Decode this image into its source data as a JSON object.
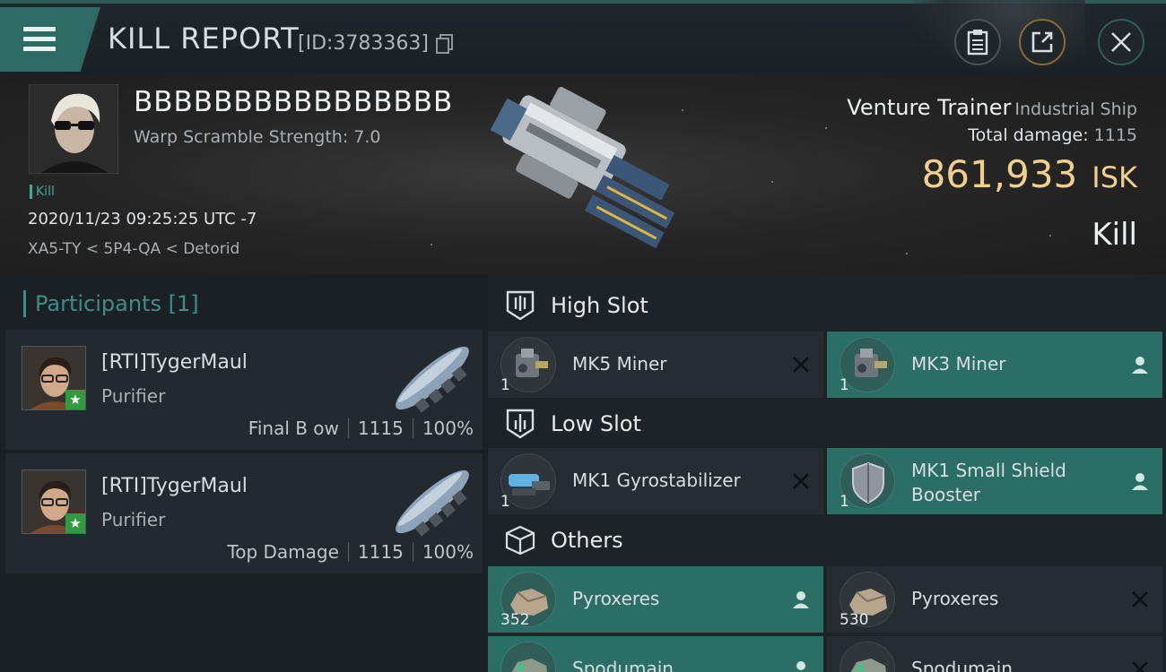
{
  "header": {
    "title": "KILL REPORT",
    "report_id": "[ID:3783363]"
  },
  "victim": {
    "name": "BBBBBBBBBBBBBBBB",
    "warp_scramble": "Warp Scramble Strength: 7.0",
    "tag": "Kill",
    "datetime": "2020/11/23 09:25:25 UTC -7",
    "location": "XA5-TY < 5P4-QA < Detorid"
  },
  "ship": {
    "name": "Venture Trainer",
    "class": "Industrial Ship",
    "total_damage_label": "Total damage:",
    "total_damage": "1115",
    "isk_value": "861,933",
    "isk_unit": "ISK",
    "result": "Kill"
  },
  "participants": {
    "title": "Participants",
    "count": "[1]",
    "rows": [
      {
        "pilot": "[RTI]TygerMaul",
        "ship": "Purifier",
        "role": "Final B ow",
        "damage": "1115",
        "percent": "100%"
      },
      {
        "pilot": "[RTI]TygerMaul",
        "ship": "Purifier",
        "role": "Top Damage",
        "damage": "1115",
        "percent": "100%"
      }
    ]
  },
  "slots": {
    "high": {
      "title": "High Slot",
      "items": [
        {
          "name": "MK5 Miner",
          "qty": "1",
          "status": "destroyed"
        },
        {
          "name": "MK3 Miner",
          "qty": "1",
          "status": "dropped"
        }
      ]
    },
    "low": {
      "title": "Low Slot",
      "items": [
        {
          "name": "MK1 Gyrostabilizer",
          "qty": "1",
          "status": "destroyed"
        },
        {
          "name": "MK1 Small Shield Booster",
          "qty": "1",
          "status": "dropped"
        }
      ]
    },
    "others": {
      "title": "Others",
      "items": [
        {
          "name": "Pyroxeres",
          "qty": "352",
          "status": "dropped"
        },
        {
          "name": "Pyroxeres",
          "qty": "530",
          "status": "destroyed"
        },
        {
          "name": "Spodumain",
          "qty": "",
          "status": "dropped"
        },
        {
          "name": "Spodumain",
          "qty": "",
          "status": "destroyed"
        }
      ]
    }
  },
  "colors": {
    "accent": "#2b6e66",
    "isk": "#f2cf8a",
    "panel": "#262d32"
  }
}
